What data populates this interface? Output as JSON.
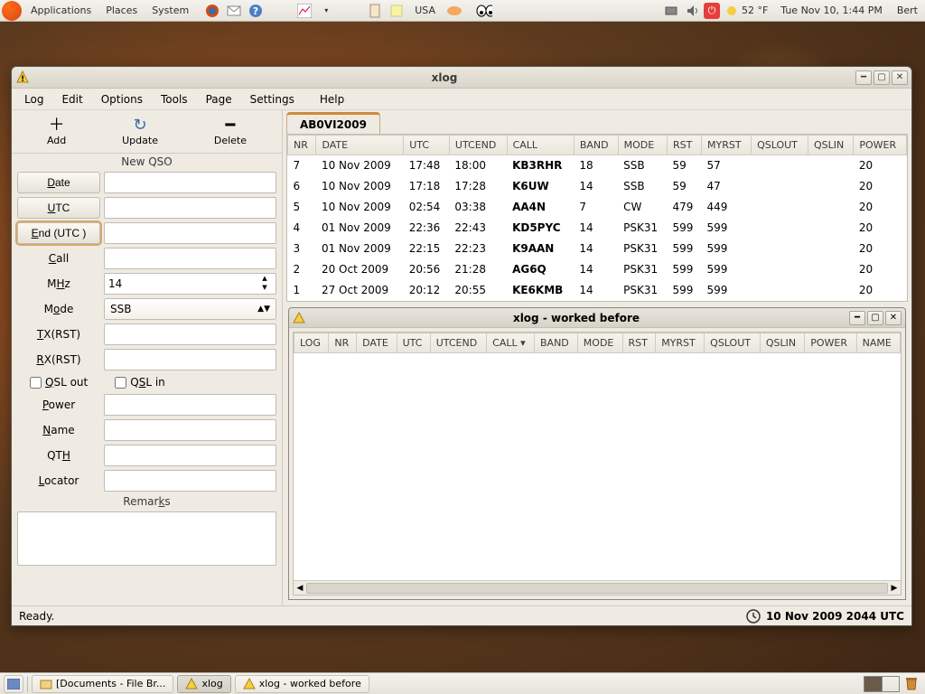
{
  "top_panel": {
    "menus": [
      "Applications",
      "Places",
      "System"
    ],
    "keyboard": "USA",
    "weather_temp": "52 °F",
    "clock": "Tue Nov 10,  1:44 PM",
    "user": "Bert"
  },
  "bottom_panel": {
    "tasks": [
      {
        "label": "[Documents - File Br...",
        "active": false
      },
      {
        "label": "xlog",
        "active": true
      },
      {
        "label": "xlog - worked before",
        "active": false
      }
    ]
  },
  "window": {
    "title": "xlog",
    "menus": [
      "Log",
      "Edit",
      "Options",
      "Tools",
      "Page",
      "Settings",
      "Help"
    ],
    "toolbar": {
      "add": "Add",
      "update": "Update",
      "delete": "Delete"
    },
    "section": "New QSO",
    "form": {
      "date_btn": "Date",
      "utc_btn": "UTC",
      "end_btn": "End (UTC )",
      "call": "Call",
      "mhz": "MHz",
      "mhz_value": "14",
      "mode": "Mode",
      "mode_value": "SSB",
      "txrst": "TX(RST)",
      "rxrst": "RX(RST)",
      "qsl_out": "QSL out",
      "qsl_in": "QSL in",
      "power": "Power",
      "name": "Name",
      "qth": "QTH",
      "locator": "Locator",
      "remarks": "Remarks"
    },
    "tab": "AB0VI2009",
    "columns": [
      "NR",
      "DATE",
      "UTC",
      "UTCEND",
      "CALL",
      "BAND",
      "MODE",
      "RST",
      "MYRST",
      "QSLOUT",
      "QSLIN",
      "POWER"
    ],
    "rows": [
      {
        "nr": "7",
        "date": "10 Nov 2009",
        "utc": "17:48",
        "utcend": "18:00",
        "call": "KB3RHR",
        "band": "18",
        "mode": "SSB",
        "rst": "59",
        "myrst": "57",
        "qslout": "",
        "qslin": "",
        "power": "20"
      },
      {
        "nr": "6",
        "date": "10 Nov 2009",
        "utc": "17:18",
        "utcend": "17:28",
        "call": "K6UW",
        "band": "14",
        "mode": "SSB",
        "rst": "59",
        "myrst": "47",
        "qslout": "",
        "qslin": "",
        "power": "20"
      },
      {
        "nr": "5",
        "date": "10 Nov 2009",
        "utc": "02:54",
        "utcend": "03:38",
        "call": "AA4N",
        "band": "7",
        "mode": "CW",
        "rst": "479",
        "myrst": "449",
        "qslout": "",
        "qslin": "",
        "power": "20"
      },
      {
        "nr": "4",
        "date": "01 Nov 2009",
        "utc": "22:36",
        "utcend": "22:43",
        "call": "KD5PYC",
        "band": "14",
        "mode": "PSK31",
        "rst": "599",
        "myrst": "599",
        "qslout": "",
        "qslin": "",
        "power": "20"
      },
      {
        "nr": "3",
        "date": "01 Nov 2009",
        "utc": "22:15",
        "utcend": "22:23",
        "call": "K9AAN",
        "band": "14",
        "mode": "PSK31",
        "rst": "599",
        "myrst": "599",
        "qslout": "",
        "qslin": "",
        "power": "20"
      },
      {
        "nr": "2",
        "date": "20 Oct 2009",
        "utc": "20:56",
        "utcend": "21:28",
        "call": "AG6Q",
        "band": "14",
        "mode": "PSK31",
        "rst": "599",
        "myrst": "599",
        "qslout": "",
        "qslin": "",
        "power": "20"
      },
      {
        "nr": "1",
        "date": "27 Oct 2009",
        "utc": "20:12",
        "utcend": "20:55",
        "call": "KE6KMB",
        "band": "14",
        "mode": "PSK31",
        "rst": "599",
        "myrst": "599",
        "qslout": "",
        "qslin": "",
        "power": "20"
      }
    ],
    "sub_window": {
      "title": "xlog - worked before",
      "columns": [
        "LOG",
        "NR",
        "DATE",
        "UTC",
        "UTCEND",
        "CALL ▾",
        "BAND",
        "MODE",
        "RST",
        "MYRST",
        "QSLOUT",
        "QSLIN",
        "POWER",
        "NAME"
      ]
    },
    "status_left": "Ready.",
    "status_right": "10 Nov 2009 2044 UTC"
  }
}
